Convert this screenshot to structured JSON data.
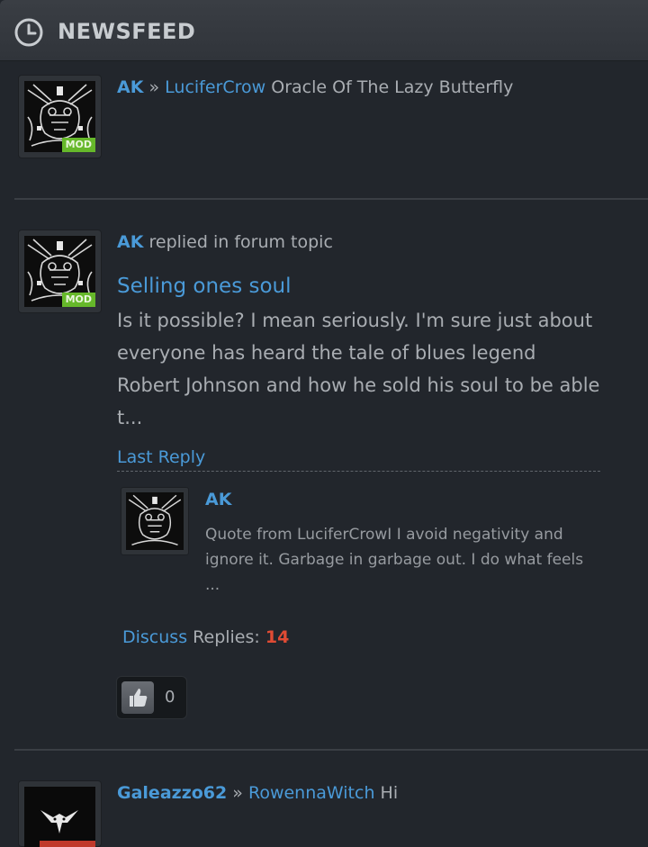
{
  "header": {
    "title": "NEWSFEED"
  },
  "items": [
    {
      "badge": "MOD",
      "actor": "AK",
      "separator": "»",
      "target": "LuciferCrow",
      "text": "Oracle Of The Lazy Butterfly"
    },
    {
      "badge": "MOD",
      "actor": "AK",
      "action": "replied in forum topic",
      "topic_title": "Selling ones soul",
      "excerpt": "Is it possible? I mean seriously. I'm sure just about everyone has heard the tale of blues legend Robert Johnson and how he sold his soul to be able t...",
      "last_reply_label": "Last Reply",
      "last_reply": {
        "user": "AK",
        "quote": "Quote from LuciferCrowI I avoid negativity and ignore it. Garbage in garbage out. I do what feels ..."
      },
      "discuss_label": "Discuss",
      "replies_label": "Replies:",
      "replies_count": "14",
      "likes": "0"
    },
    {
      "actor": "Galeazzo62",
      "separator": "»",
      "target": "RowennaWitch",
      "text": "Hi"
    }
  ]
}
